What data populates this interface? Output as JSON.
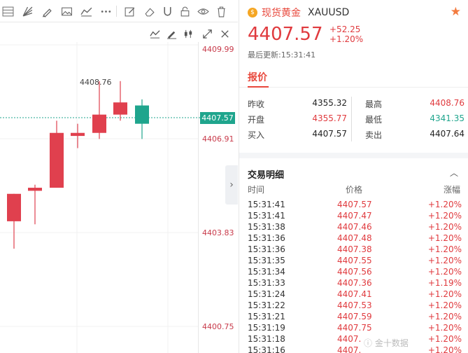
{
  "toolbar": {
    "tools": [
      "fib-retracement-icon",
      "fan-icon",
      "brush-icon",
      "image-icon",
      "trend-icon",
      "more-icon",
      "edit-icon",
      "eraser-icon",
      "magnet-icon",
      "lock-icon",
      "eye-icon",
      "trash-icon"
    ],
    "sub_tools": [
      "indicator-icon",
      "draw-icon",
      "candle-type-icon",
      "expand-icon",
      "close-icon"
    ]
  },
  "chart": {
    "y_labels": [
      "4409.99",
      "4406.91",
      "4403.83",
      "4400.75"
    ],
    "current_price_tag": "4407.57",
    "peak_label": "4408.76"
  },
  "chart_data": {
    "type": "candlestick",
    "ylim": [
      4399.5,
      4410.6
    ],
    "up_color": "#1fa58d",
    "down_color": "#e0404e",
    "series": [
      {
        "open": 4405.1,
        "high": 4405.1,
        "low": 4403.3,
        "close": 4404.2
      },
      {
        "open": 4405.3,
        "high": 4405.4,
        "low": 4404.1,
        "close": 4405.2
      },
      {
        "open": 4407.1,
        "high": 4407.5,
        "low": 4405.3,
        "close": 4405.3
      },
      {
        "open": 4407.1,
        "high": 4407.4,
        "low": 4406.6,
        "close": 4407.0
      },
      {
        "open": 4407.7,
        "high": 4408.8,
        "low": 4406.9,
        "close": 4407.1
      },
      {
        "open": 4408.1,
        "high": 4408.8,
        "low": 4407.5,
        "close": 4407.7
      },
      {
        "open": 4407.4,
        "high": 4408.2,
        "low": 4406.9,
        "close": 4408.0
      }
    ]
  },
  "quote": {
    "name_cn": "现货黄金",
    "symbol": "XAUUSD",
    "last_price": "4407.57",
    "change": "+52.25",
    "change_pct": "+1.20%",
    "update_label": "最后更新:15:31:41",
    "tab_label": "报价",
    "stats": {
      "prev_close_label": "昨收",
      "prev_close": "4355.32",
      "open_label": "开盘",
      "open": "4355.77",
      "bid_label": "买入",
      "bid": "4407.57",
      "high_label": "最高",
      "high": "4408.76",
      "low_label": "最低",
      "low": "4341.35",
      "ask_label": "卖出",
      "ask": "4407.64"
    },
    "colors": {
      "up": "#e03a3e",
      "down": "#1fa58d",
      "brand": "#e8483c"
    }
  },
  "trades": {
    "title": "交易明细",
    "headers": {
      "time": "时间",
      "price": "价格",
      "change": "涨幅"
    },
    "rows": [
      {
        "time": "15:31:41",
        "price": "4407.57",
        "change": "+1.20%"
      },
      {
        "time": "15:31:41",
        "price": "4407.47",
        "change": "+1.20%"
      },
      {
        "time": "15:31:38",
        "price": "4407.46",
        "change": "+1.20%"
      },
      {
        "time": "15:31:36",
        "price": "4407.48",
        "change": "+1.20%"
      },
      {
        "time": "15:31:36",
        "price": "4407.38",
        "change": "+1.20%"
      },
      {
        "time": "15:31:35",
        "price": "4407.55",
        "change": "+1.20%"
      },
      {
        "time": "15:31:34",
        "price": "4407.56",
        "change": "+1.20%"
      },
      {
        "time": "15:31:33",
        "price": "4407.36",
        "change": "+1.19%"
      },
      {
        "time": "15:31:24",
        "price": "4407.41",
        "change": "+1.20%"
      },
      {
        "time": "15:31:22",
        "price": "4407.53",
        "change": "+1.20%"
      },
      {
        "time": "15:31:21",
        "price": "4407.59",
        "change": "+1.20%"
      },
      {
        "time": "15:31:19",
        "price": "4407.75",
        "change": "+1.20%"
      },
      {
        "time": "15:31:18",
        "price": "4407.",
        "change": "+1.20%"
      },
      {
        "time": "15:31:16",
        "price": "4407.",
        "change": "+1.20%"
      }
    ]
  }
}
